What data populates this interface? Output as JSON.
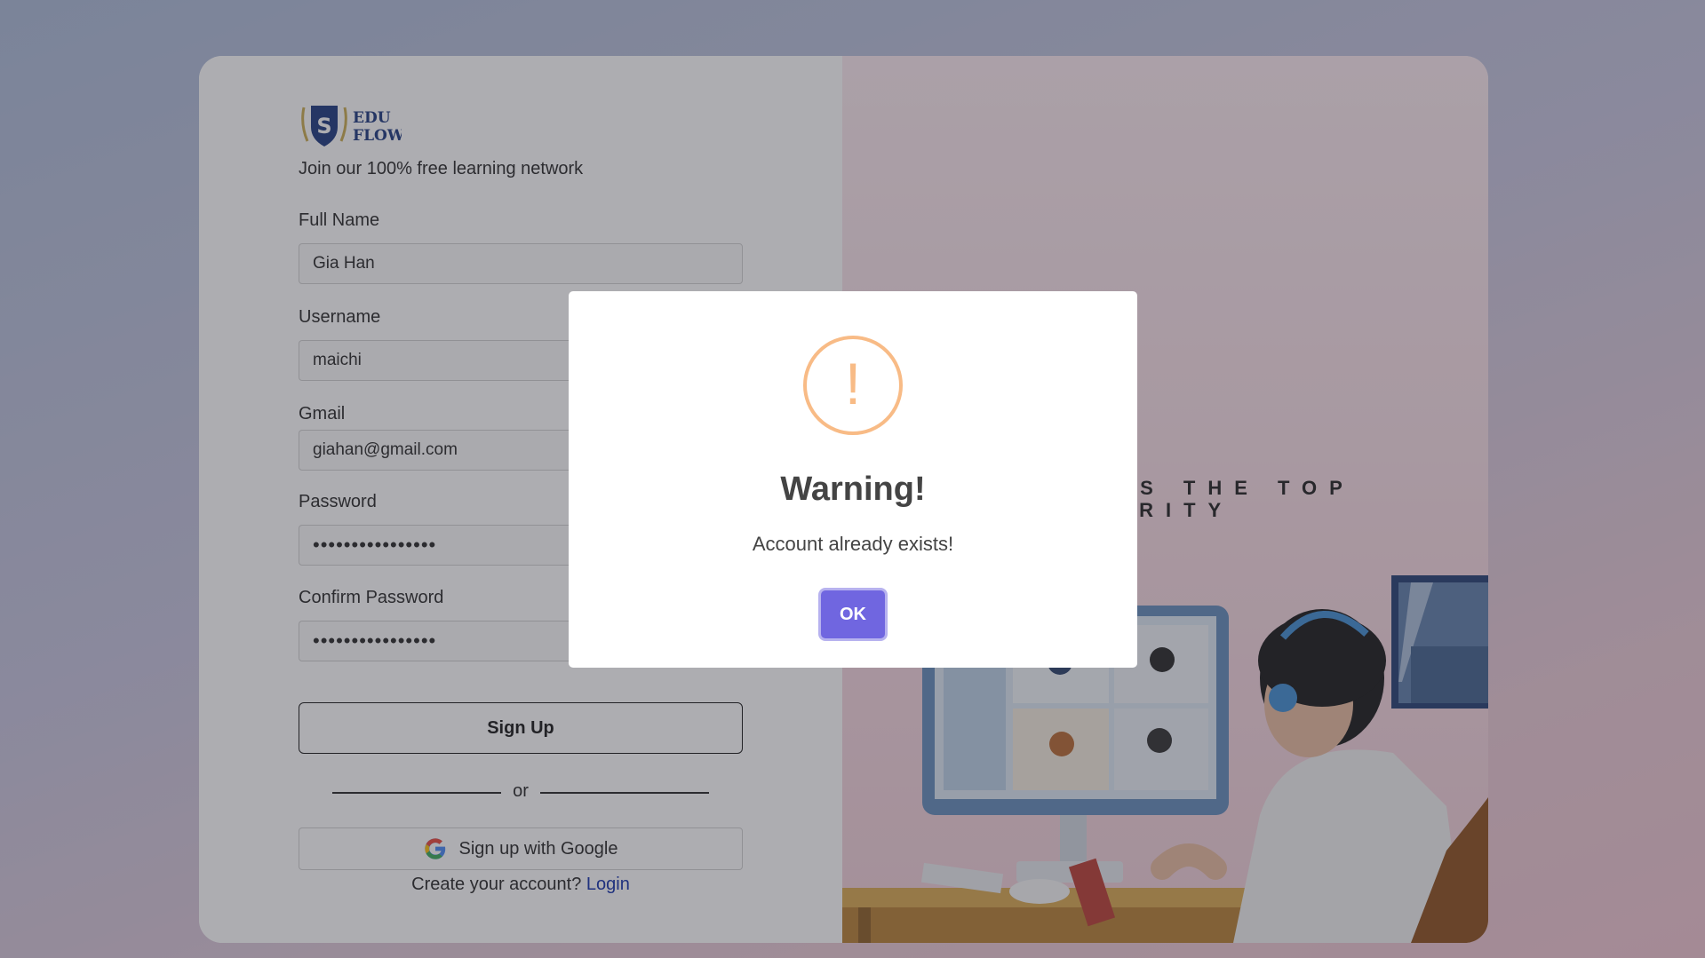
{
  "brand": {
    "logo_letter": "S",
    "logo_line1": "EDU",
    "logo_line2": "FLOW"
  },
  "tagline": "Join our 100% free learning network",
  "form": {
    "fullname": {
      "label": "Full Name",
      "value": "Gia Han"
    },
    "username": {
      "label": "Username",
      "value": "maichi"
    },
    "gmail": {
      "label": "Gmail",
      "value": "giahan@gmail.com"
    },
    "password": {
      "label": "Password",
      "value": "••••••••••••••••"
    },
    "confirm": {
      "label": "Confirm Password",
      "value": "••••••••••••••••"
    },
    "submit_label": "Sign Up",
    "or_text": "or",
    "google_label": "Sign up with Google",
    "create_prompt": "Create your account?",
    "login_link": "Login"
  },
  "banner": {
    "line1": "N IS THE TOP",
    "line2": "ORITY"
  },
  "modal": {
    "icon_char": "!",
    "title": "Warning!",
    "message": "Account already exists!",
    "ok_label": "OK"
  },
  "colors": {
    "warning": "#f8bb86",
    "confirm_button": "#7066e0",
    "link": "#0b2aa8"
  }
}
